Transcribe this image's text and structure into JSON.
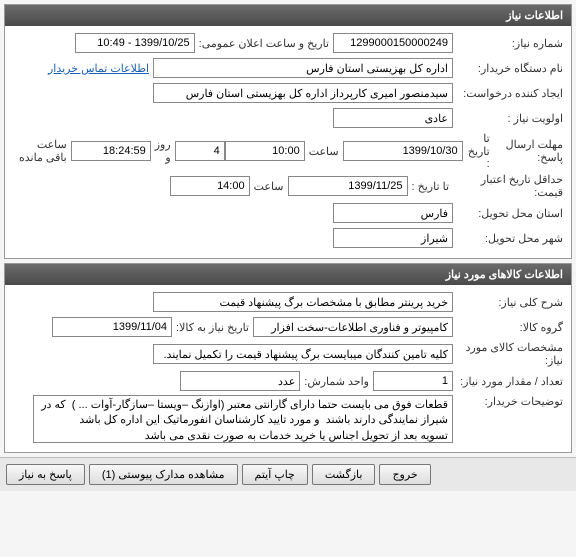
{
  "panel1": {
    "title": "اطلاعات نیاز",
    "need_number_label": "شماره نیاز:",
    "need_number": "1299000150000249",
    "public_datetime_label": "تاریخ و ساعت اعلان عمومی:",
    "public_datetime": "1399/10/25 - 10:49",
    "buyer_label": "نام دستگاه خریدار:",
    "buyer": "اداره کل بهزیستی استان فارس",
    "contact_link": "اطلاعات تماس خریدار",
    "creator_label": "ایجاد کننده درخواست:",
    "creator": "سیدمنصور امیری کارپرداز اداره کل بهزیستی استان فارس",
    "priority_label": "اولویت نیاز :",
    "priority": "عادی",
    "deadline_label": "مهلت ارسال پاسخ:",
    "until_label": "تا تاریخ :",
    "deadline_date": "1399/10/30",
    "time_label": "ساعت",
    "deadline_time": "10:00",
    "days_remaining": "4",
    "days_label": "روز و",
    "time_remaining": "18:24:59",
    "remaining_label": "ساعت باقی مانده",
    "min_validity_label": "حداقل تاریخ اعتبار قیمت:",
    "min_validity_until": "تا تاریخ :",
    "min_validity_date": "1399/11/25",
    "min_validity_time": "14:00",
    "province_label": "استان محل تحویل:",
    "province": "فارس",
    "city_label": "شهر محل تحویل:",
    "city": "شیراز"
  },
  "panel2": {
    "title": "اطلاعات کالاهای مورد نیاز",
    "general_desc_label": "شرح کلی نیاز:",
    "general_desc": "خرید پرینتر مطابق با مشخصات برگ پیشنهاد قیمت",
    "group_label": "گروه کالا:",
    "group": "کامپیوتر و فناوری اطلاعات-سخت افزار",
    "need_date_label": "تاریخ نیاز به کالا:",
    "need_date": "1399/11/04",
    "specs_label": "مشخصات کالای مورد نیاز:",
    "specs": "کلیه تامین کنندگان میبایست برگ پیشنهاد قیمت را تکمیل نمایند.",
    "qty_label": "تعداد / مقدار مورد نیاز:",
    "qty": "1",
    "unit_label": "واحد شمارش:",
    "unit": "عدد",
    "buyer_notes_label": "توضیحات خریدار:",
    "buyer_notes": "قطعات فوق می بایست حتما دارای گارانتی معتبر (اوازنگ –ویستا –سازگار-آوات ... )  که در شیراز نمایندگی دارند باشند  و مورد تایید کارشناسان انفورماتیک این اداره کل باشد\nتسویه بعد از تحویل اجناس یا خرید خدمات به صورت نقدی می باشد"
  },
  "buttons": {
    "respond": "پاسخ به نیاز",
    "attachments": "مشاهده مدارک پیوستی (1)",
    "print": "چاپ آیتم",
    "back": "بازگشت",
    "exit": "خروج"
  }
}
